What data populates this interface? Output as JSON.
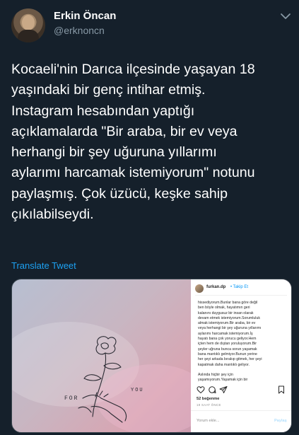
{
  "author": {
    "display_name": "Erkin Öncan",
    "handle": "@erknoncn"
  },
  "tweet": {
    "lines": [
      "Kocaeli'nin Darıca ilçesinde yaşayan 18",
      "yaşındaki bir genç intihar etmiş.",
      "Instagram hesabından yaptığı",
      "açıklamalarda \"Bir araba, bir ev veya",
      "herhangi bir şey uğuruna yıllarımı",
      "aylarımı harcamak istemiyorum\" notunu",
      "paylaşmış. Çok üzücü, keşke sahip",
      "çıkılabilseydi."
    ],
    "translate_label": "Translate Tweet"
  },
  "media": {
    "sketch_text_left": "FOR",
    "sketch_text_right": "YOU",
    "instagram": {
      "username": "furkan.dp",
      "follow_label": "• Takip Et",
      "caption_lines": [
        "hissediyorum.Bunlar bana göre değil",
        "ben böyle olmak, hayatımın geri",
        "kalanını duygusuz bir insan olarak",
        "devam etmek istemiyorum.Sorumluluk",
        "almak istemiyorum.Bir araba, bir ev",
        "veya herhangi bir şey uğuruna yıllarımı",
        "aylarımı harcamak istemiyorum.İş",
        "hayatı bana çok yorucu geliyor.Hem",
        "içten hem de dıştan yoruluyorum.Bir",
        "şeyler uğruna bunca sorun yaşamak",
        "bana mantıklı gelmiyor.Bunun yerine",
        "her şeyi arkada bırakıp gitmek, her şeyi",
        "kapatmak daha mantıklı geliyor.",
        "",
        "Aslında hiçbir şey için",
        "yaşamıyorum.Yaşamak için bir"
      ],
      "likes": "52 beğenme",
      "time": "19 SAAT ÖNCE",
      "comment_placeholder": "Yorum ekle...",
      "share_label": "Paylaş"
    }
  },
  "colors": {
    "background": "#15202b",
    "secondary_text": "#8899a6",
    "link": "#1da1f2"
  },
  "icons": {
    "caret": "chevron-down-icon",
    "like": "heart-icon",
    "comment": "comment-icon",
    "share": "paper-plane-icon",
    "save": "bookmark-icon"
  }
}
